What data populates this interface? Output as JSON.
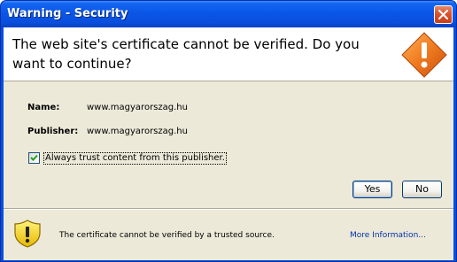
{
  "window": {
    "title": "Warning - Security"
  },
  "dialog": {
    "message": "The web site's certificate cannot be verified.  Do you want to continue?",
    "name_label": "Name:",
    "name_value": "www.magyarorszag.hu",
    "publisher_label": "Publisher:",
    "publisher_value": "www.magyarorszag.hu",
    "always_trust_label": "Always trust content from this publisher.",
    "always_trust_checked": true,
    "yes_label": "Yes",
    "no_label": "No"
  },
  "footer": {
    "text": "The certificate cannot be verified by a trusted source.",
    "more_info_link": "More Information..."
  },
  "icons": {
    "close": "close-icon",
    "warning": "warning-diamond-icon",
    "shield": "shield-warning-icon",
    "check": "checkmark-icon"
  },
  "colors": {
    "titlebar": "#0a4de0",
    "client_bg": "#ece9d8",
    "warning_orange": "#f07a1e",
    "link": "#0033aa"
  }
}
